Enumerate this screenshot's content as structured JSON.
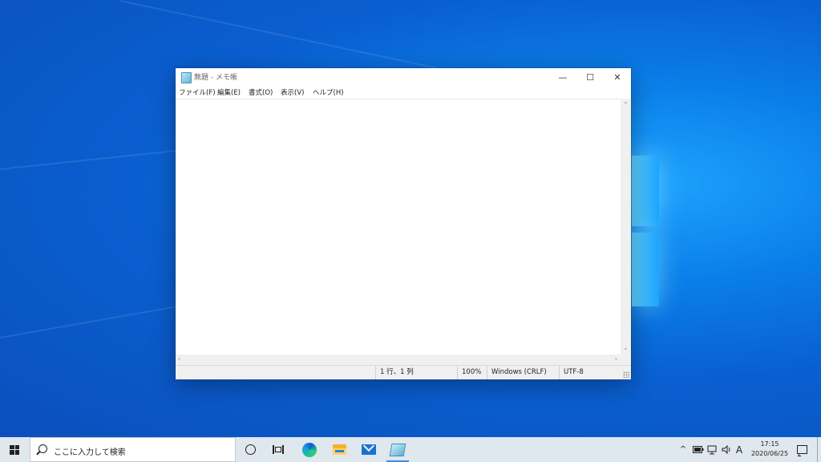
{
  "window": {
    "title": "無題 - メモ帳",
    "app_icon": "notepad-icon",
    "controls": {
      "minimize": "—",
      "maximize": "☐",
      "close": "✕"
    }
  },
  "menu": {
    "items": [
      {
        "label": "ファイル(F)"
      },
      {
        "label": "編集(E)"
      },
      {
        "label": "書式(O)"
      },
      {
        "label": "表示(V)"
      },
      {
        "label": "ヘルプ(H)"
      }
    ]
  },
  "editor": {
    "content": ""
  },
  "statusbar": {
    "position": "1 行、1 列",
    "zoom": "100%",
    "line_ending": "Windows (CRLF)",
    "encoding": "UTF-8"
  },
  "taskbar": {
    "search_placeholder": "ここに入力して検索",
    "pinned": [
      "cortana-icon",
      "task-view-icon",
      "edge-icon",
      "file-explorer-icon",
      "mail-icon",
      "notepad-icon"
    ],
    "tray": {
      "chevron": "^",
      "ime": "A",
      "time": "17:15",
      "date": "2020/06/25"
    }
  },
  "colors": {
    "desktop_blue": "#0a7ee8",
    "taskbar": "#dfe7ef",
    "active_indicator": "#3d8ee0"
  }
}
